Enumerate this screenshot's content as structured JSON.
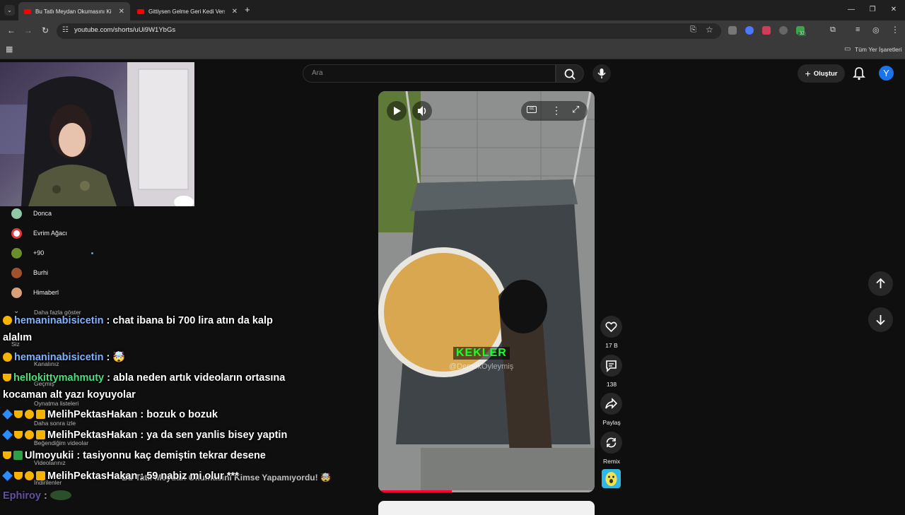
{
  "browser": {
    "tabs": [
      {
        "title": "Bu Tatlı Meydan Okumasını Kim",
        "active": true
      },
      {
        "title": "Gittiysen Gelme Geri Kedi Versi",
        "active": false
      }
    ],
    "new_tab": "+",
    "url": "youtube.com/shorts/uUi9W1YbGs",
    "bookmarks_label": "Tüm Yer İşaretleri",
    "extension_badge": "32"
  },
  "youtube": {
    "search_placeholder": "Ara",
    "create_label": "Oluştur",
    "avatar_letter": "Y",
    "accent": "#ff0033"
  },
  "sidebar": {
    "channels": [
      {
        "name": "Donca",
        "color": "#8fc9a8"
      },
      {
        "name": "Evrim Ağacı",
        "color": "#e23b3b"
      },
      {
        "name": "+90",
        "color": "#6a8f2a"
      },
      {
        "name": "Burhi",
        "color": "#a0522d"
      },
      {
        "name": "Himaberl",
        "color": "#d9a07a"
      }
    ],
    "show_more": "Daha fazla göster",
    "you_section": "Siz",
    "library": [
      "Kanalınız",
      "Geçmiş",
      "Oynatma listeleri",
      "Daha sonra izle",
      "Beğendiğim videolar",
      "Videolarınız",
      "İndirilenler"
    ]
  },
  "chat": {
    "messages": [
      {
        "user": "hemaninabisicetin",
        "text": ": chat ibana bi 700 lira atın da kalp",
        "cont": "alalım"
      },
      {
        "user": "hemaninabisicetin",
        "text": ": 🤯"
      },
      {
        "user": "hellokittymahmuty",
        "text": ": abla neden artık videoların ortasına",
        "cont": "kocaman alt yazı koyuyolar"
      },
      {
        "user": "MelihPektasHakan",
        "text": ": bozuk o bozuk"
      },
      {
        "user": "MelihPektasHakan",
        "text": ": ya da sen yanlis bisey yaptin"
      },
      {
        "user": "Ulmoyukii",
        "text": ": tasiyonnu kaç demiştin tekrar desene"
      },
      {
        "user": "MelihPektasHakan",
        "text": ": 59 nabiz mi olur ***"
      },
      {
        "user": "Ephiroy",
        "text": ":"
      }
    ],
    "ghost_title": "Bu Tatlı Meydan Okumasını Kimse Yapamıyordu! 🤯"
  },
  "video": {
    "caption": "KEKLER",
    "watermark": "@DemekOyleymiş",
    "progress": 0.34
  },
  "actions": {
    "likes": "17 B",
    "comments": "138",
    "share": "Paylaş",
    "remix": "Remix"
  }
}
